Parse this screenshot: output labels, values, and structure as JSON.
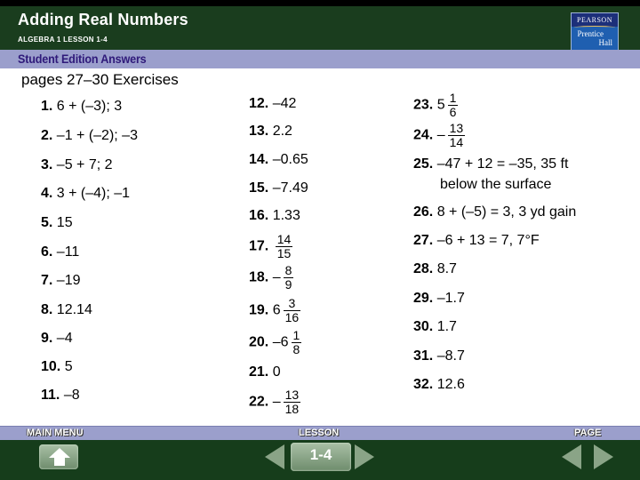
{
  "header": {
    "title": "Adding Real Numbers",
    "subtitle": "ALGEBRA 1  LESSON 1-4",
    "logo_top": "PEARSON",
    "logo_line1": "Prentice",
    "logo_line2": "Hall"
  },
  "band": {
    "label": "Student Edition Answers"
  },
  "section": {
    "title": "pages 27–30  Exercises"
  },
  "answers": {
    "a1": {
      "num": "1.",
      "text": "6 + (–3); 3"
    },
    "a2": {
      "num": "2.",
      "text": "–1 + (–2); –3"
    },
    "a3": {
      "num": "3.",
      "text": "–5 + 7; 2"
    },
    "a4": {
      "num": "4.",
      "text": "3 + (–4); –1"
    },
    "a5": {
      "num": "5.",
      "text": "15"
    },
    "a6": {
      "num": "6.",
      "text": "–11"
    },
    "a7": {
      "num": "7.",
      "text": "–19"
    },
    "a8": {
      "num": "8.",
      "text": "12.14"
    },
    "a9": {
      "num": "9.",
      "text": "–4"
    },
    "a10": {
      "num": "10.",
      "text": "5"
    },
    "a11": {
      "num": "11.",
      "text": "–8"
    },
    "a12": {
      "num": "12.",
      "text": "–42"
    },
    "a13": {
      "num": "13.",
      "text": "2.2"
    },
    "a14": {
      "num": "14.",
      "text": "–0.65"
    },
    "a15": {
      "num": "15.",
      "text": "–7.49"
    },
    "a16": {
      "num": "16.",
      "text": "1.33"
    },
    "a17": {
      "num": "17.",
      "prefix": "",
      "n": "14",
      "d": "15"
    },
    "a18": {
      "num": "18.",
      "prefix": "–",
      "n": "8",
      "d": "9"
    },
    "a19": {
      "num": "19.",
      "prefix": "6",
      "n": "3",
      "d": "16"
    },
    "a20": {
      "num": "20.",
      "prefix": "–6",
      "n": "1",
      "d": "8"
    },
    "a21": {
      "num": "21.",
      "text": "0"
    },
    "a22": {
      "num": "22.",
      "prefix": "–",
      "n": "13",
      "d": "18"
    },
    "a23": {
      "num": "23.",
      "prefix": "5",
      "n": "1",
      "d": "6"
    },
    "a24": {
      "num": "24.",
      "prefix": "–",
      "n": "13",
      "d": "14"
    },
    "a25": {
      "num": "25.",
      "text": "–47 + 12 = –35, 35 ft",
      "text2": "below the surface"
    },
    "a26": {
      "num": "26.",
      "text": "8 + (–5) = 3, 3 yd gain"
    },
    "a27": {
      "num": "27.",
      "text": "–6 + 13 = 7, 7°F"
    },
    "a28": {
      "num": "28.",
      "text": "8.7"
    },
    "a29": {
      "num": "29.",
      "text": "–1.7"
    },
    "a30": {
      "num": "30.",
      "text": "1.7"
    },
    "a31": {
      "num": "31.",
      "text": "–8.7"
    },
    "a32": {
      "num": "32.",
      "text": "12.6"
    }
  },
  "footer": {
    "main_menu_label": "MAIN MENU",
    "lesson_label": "LESSON",
    "page_label": "PAGE",
    "lesson_value": "1-4",
    "icons": {
      "home": "home-icon",
      "prev": "triangle-left-icon",
      "next": "triangle-right-icon"
    }
  }
}
